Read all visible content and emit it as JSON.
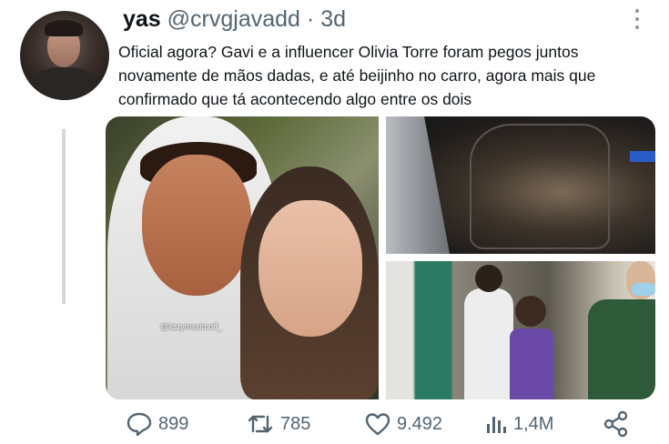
{
  "user": {
    "display_name": "yas",
    "handle": "@crvgjavadd",
    "separator": "·",
    "time_ago": "3d"
  },
  "tweet": {
    "text": "Oficial agora? Gavi e a influencer Olivia Torre foram pegos juntos novamente de mãos dadas, e até beijinho no carro, agora mais que confirmado que tá acontecendo algo entre os dois"
  },
  "media": {
    "watermark": "@lizzymaximoff_"
  },
  "actions": {
    "replies": "899",
    "retweets": "785",
    "likes": "9.492",
    "views": "1,4M"
  },
  "icons": {
    "more": "more-vertical-icon",
    "reply": "reply-icon",
    "retweet": "retweet-icon",
    "like": "heart-icon",
    "views": "views-icon",
    "share": "share-icon"
  },
  "colors": {
    "text": "#0f1419",
    "secondary": "#536471",
    "thread_line": "#cfd9de"
  }
}
